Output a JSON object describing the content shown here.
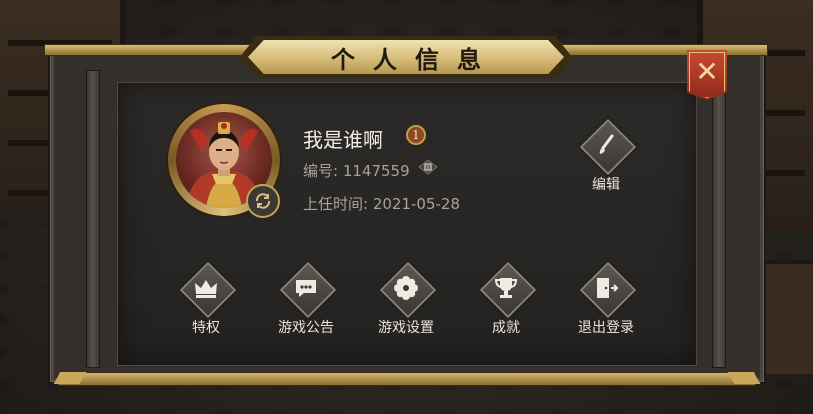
{
  "window": {
    "title": "个人信息",
    "close_icon": "close-icon"
  },
  "profile": {
    "name": "我是谁啊",
    "rank": "1",
    "id_label": "编号: 1147559",
    "appointed_label": "上任时间: 2021-05-28"
  },
  "edit": {
    "label": "编辑",
    "icon": "brush-icon"
  },
  "menu": [
    {
      "label": "特权",
      "icon": "crown-icon"
    },
    {
      "label": "游戏公告",
      "icon": "chat-icon"
    },
    {
      "label": "游戏设置",
      "icon": "gear-icon"
    },
    {
      "label": "成就",
      "icon": "trophy-icon"
    },
    {
      "label": "退出登录",
      "icon": "logout-icon"
    }
  ],
  "colors": {
    "gold": "#d9bf7d",
    "close_red": "#b23b26",
    "panel": "#2c2a28"
  }
}
